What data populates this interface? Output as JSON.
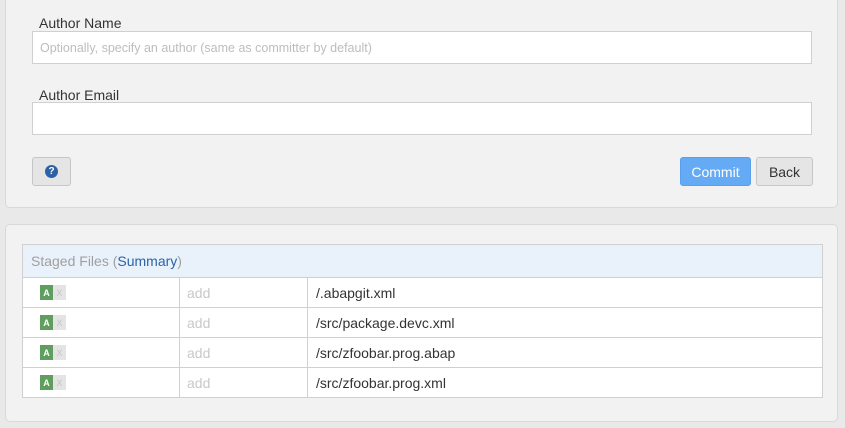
{
  "form": {
    "author_name_label": "Author Name",
    "author_name_placeholder": "Optionally, specify an author (same as committer by default)",
    "author_name_value": "",
    "author_email_label": "Author Email",
    "author_email_placeholder": "",
    "author_email_value": "",
    "help_icon_text": "?",
    "commit_label": "Commit",
    "back_label": "Back"
  },
  "staged": {
    "title_prefix": "Staged Files (",
    "summary_label": "Summary",
    "title_suffix": ")",
    "files": [
      {
        "status_added": "A",
        "status_removed": "X",
        "action": "add",
        "path": "/.abapgit.xml"
      },
      {
        "status_added": "A",
        "status_removed": "X",
        "action": "add",
        "path": "/src/package.devc.xml"
      },
      {
        "status_added": "A",
        "status_removed": "X",
        "action": "add",
        "path": "/src/zfoobar.prog.abap"
      },
      {
        "status_added": "A",
        "status_removed": "X",
        "action": "add",
        "path": "/src/zfoobar.prog.xml"
      }
    ]
  },
  "colors": {
    "commit_button": "#65aaf5",
    "link": "#2d62a6",
    "staged_header_bg": "#e9f1fa",
    "badge_added": "#5f9e5f"
  }
}
